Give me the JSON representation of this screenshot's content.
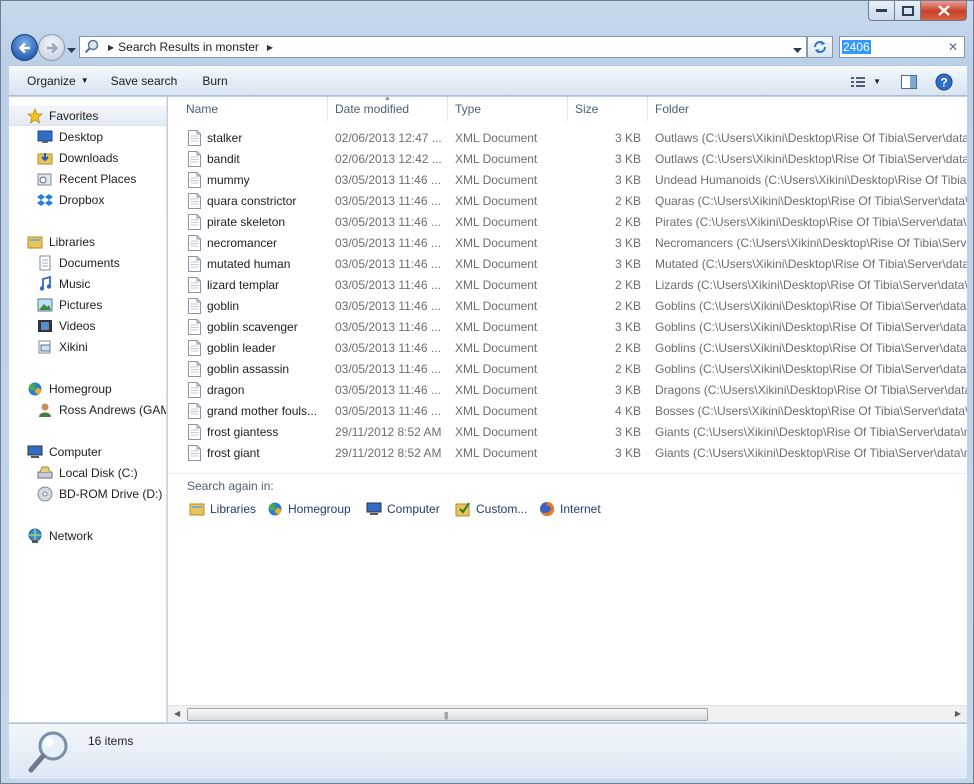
{
  "address": {
    "path": [
      "Search Results in monster"
    ]
  },
  "search": {
    "value": "2406"
  },
  "toolbar": {
    "organize_label": "Organize",
    "save_search_label": "Save search",
    "burn_label": "Burn"
  },
  "nav": {
    "favorites": {
      "label": "Favorites",
      "items": [
        "Desktop",
        "Downloads",
        "Recent Places",
        "Dropbox"
      ]
    },
    "libraries": {
      "label": "Libraries",
      "items": [
        "Documents",
        "Music",
        "Pictures",
        "Videos",
        "Xikini"
      ]
    },
    "homegroup": {
      "label": "Homegroup",
      "items": [
        "Ross Andrews (GAM"
      ]
    },
    "computer": {
      "label": "Computer",
      "items": [
        "Local Disk (C:)",
        "BD-ROM Drive (D:) F"
      ]
    },
    "network": {
      "label": "Network"
    }
  },
  "columns": [
    "Name",
    "Date modified",
    "Type",
    "Size",
    "Folder"
  ],
  "files": [
    {
      "name": "stalker",
      "date": "02/06/2013 12:47 ...",
      "type": "XML Document",
      "size": "3 KB",
      "folder": "Outlaws (C:\\Users\\Xikini\\Desktop\\Rise Of Tibia\\Server\\data\\m"
    },
    {
      "name": "bandit",
      "date": "02/06/2013 12:42 ...",
      "type": "XML Document",
      "size": "3 KB",
      "folder": "Outlaws (C:\\Users\\Xikini\\Desktop\\Rise Of Tibia\\Server\\data\\m"
    },
    {
      "name": "mummy",
      "date": "03/05/2013 11:46 ...",
      "type": "XML Document",
      "size": "3 KB",
      "folder": "Undead Humanoids (C:\\Users\\Xikini\\Desktop\\Rise Of Tibia"
    },
    {
      "name": "quara constrictor",
      "date": "03/05/2013 11:46 ...",
      "type": "XML Document",
      "size": "2 KB",
      "folder": "Quaras (C:\\Users\\Xikini\\Desktop\\Rise Of Tibia\\Server\\data\\"
    },
    {
      "name": "pirate skeleton",
      "date": "03/05/2013 11:46 ...",
      "type": "XML Document",
      "size": "2 KB",
      "folder": "Pirates (C:\\Users\\Xikini\\Desktop\\Rise Of Tibia\\Server\\data\\m"
    },
    {
      "name": "necromancer",
      "date": "03/05/2013 11:46 ...",
      "type": "XML Document",
      "size": "3 KB",
      "folder": "Necromancers (C:\\Users\\Xikini\\Desktop\\Rise Of Tibia\\Serve"
    },
    {
      "name": "mutated human",
      "date": "03/05/2013 11:46 ...",
      "type": "XML Document",
      "size": "3 KB",
      "folder": "Mutated (C:\\Users\\Xikini\\Desktop\\Rise Of Tibia\\Server\\data\\"
    },
    {
      "name": "lizard templar",
      "date": "03/05/2013 11:46 ...",
      "type": "XML Document",
      "size": "2 KB",
      "folder": "Lizards (C:\\Users\\Xikini\\Desktop\\Rise Of Tibia\\Server\\data\\m"
    },
    {
      "name": "goblin",
      "date": "03/05/2013 11:46 ...",
      "type": "XML Document",
      "size": "2 KB",
      "folder": "Goblins (C:\\Users\\Xikini\\Desktop\\Rise Of Tibia\\Server\\data\\"
    },
    {
      "name": "goblin scavenger",
      "date": "03/05/2013 11:46 ...",
      "type": "XML Document",
      "size": "3 KB",
      "folder": "Goblins (C:\\Users\\Xikini\\Desktop\\Rise Of Tibia\\Server\\data\\"
    },
    {
      "name": "goblin leader",
      "date": "03/05/2013 11:46 ...",
      "type": "XML Document",
      "size": "2 KB",
      "folder": "Goblins (C:\\Users\\Xikini\\Desktop\\Rise Of Tibia\\Server\\data\\"
    },
    {
      "name": "goblin assassin",
      "date": "03/05/2013 11:46 ...",
      "type": "XML Document",
      "size": "2 KB",
      "folder": "Goblins (C:\\Users\\Xikini\\Desktop\\Rise Of Tibia\\Server\\data\\"
    },
    {
      "name": "dragon",
      "date": "03/05/2013 11:46 ...",
      "type": "XML Document",
      "size": "3 KB",
      "folder": "Dragons (C:\\Users\\Xikini\\Desktop\\Rise Of Tibia\\Server\\data\\"
    },
    {
      "name": "grand mother fouls...",
      "date": "03/05/2013 11:46 ...",
      "type": "XML Document",
      "size": "4 KB",
      "folder": "Bosses (C:\\Users\\Xikini\\Desktop\\Rise Of Tibia\\Server\\data\\m"
    },
    {
      "name": "frost giantess",
      "date": "29/11/2012 8:52 AM",
      "type": "XML Document",
      "size": "3 KB",
      "folder": "Giants (C:\\Users\\Xikini\\Desktop\\Rise Of Tibia\\Server\\data\\m"
    },
    {
      "name": "frost giant",
      "date": "29/11/2012 8:52 AM",
      "type": "XML Document",
      "size": "3 KB",
      "folder": "Giants (C:\\Users\\Xikini\\Desktop\\Rise Of Tibia\\Server\\data\\m"
    }
  ],
  "search_again": {
    "label": "Search again in:",
    "items": [
      "Libraries",
      "Homegroup",
      "Computer",
      "Custom...",
      "Internet"
    ]
  },
  "status": {
    "item_count": "16 items"
  },
  "colors": {
    "selection": "#3399ff",
    "close_button": "#c8412b",
    "secondary_text": "#6d6d6d"
  }
}
